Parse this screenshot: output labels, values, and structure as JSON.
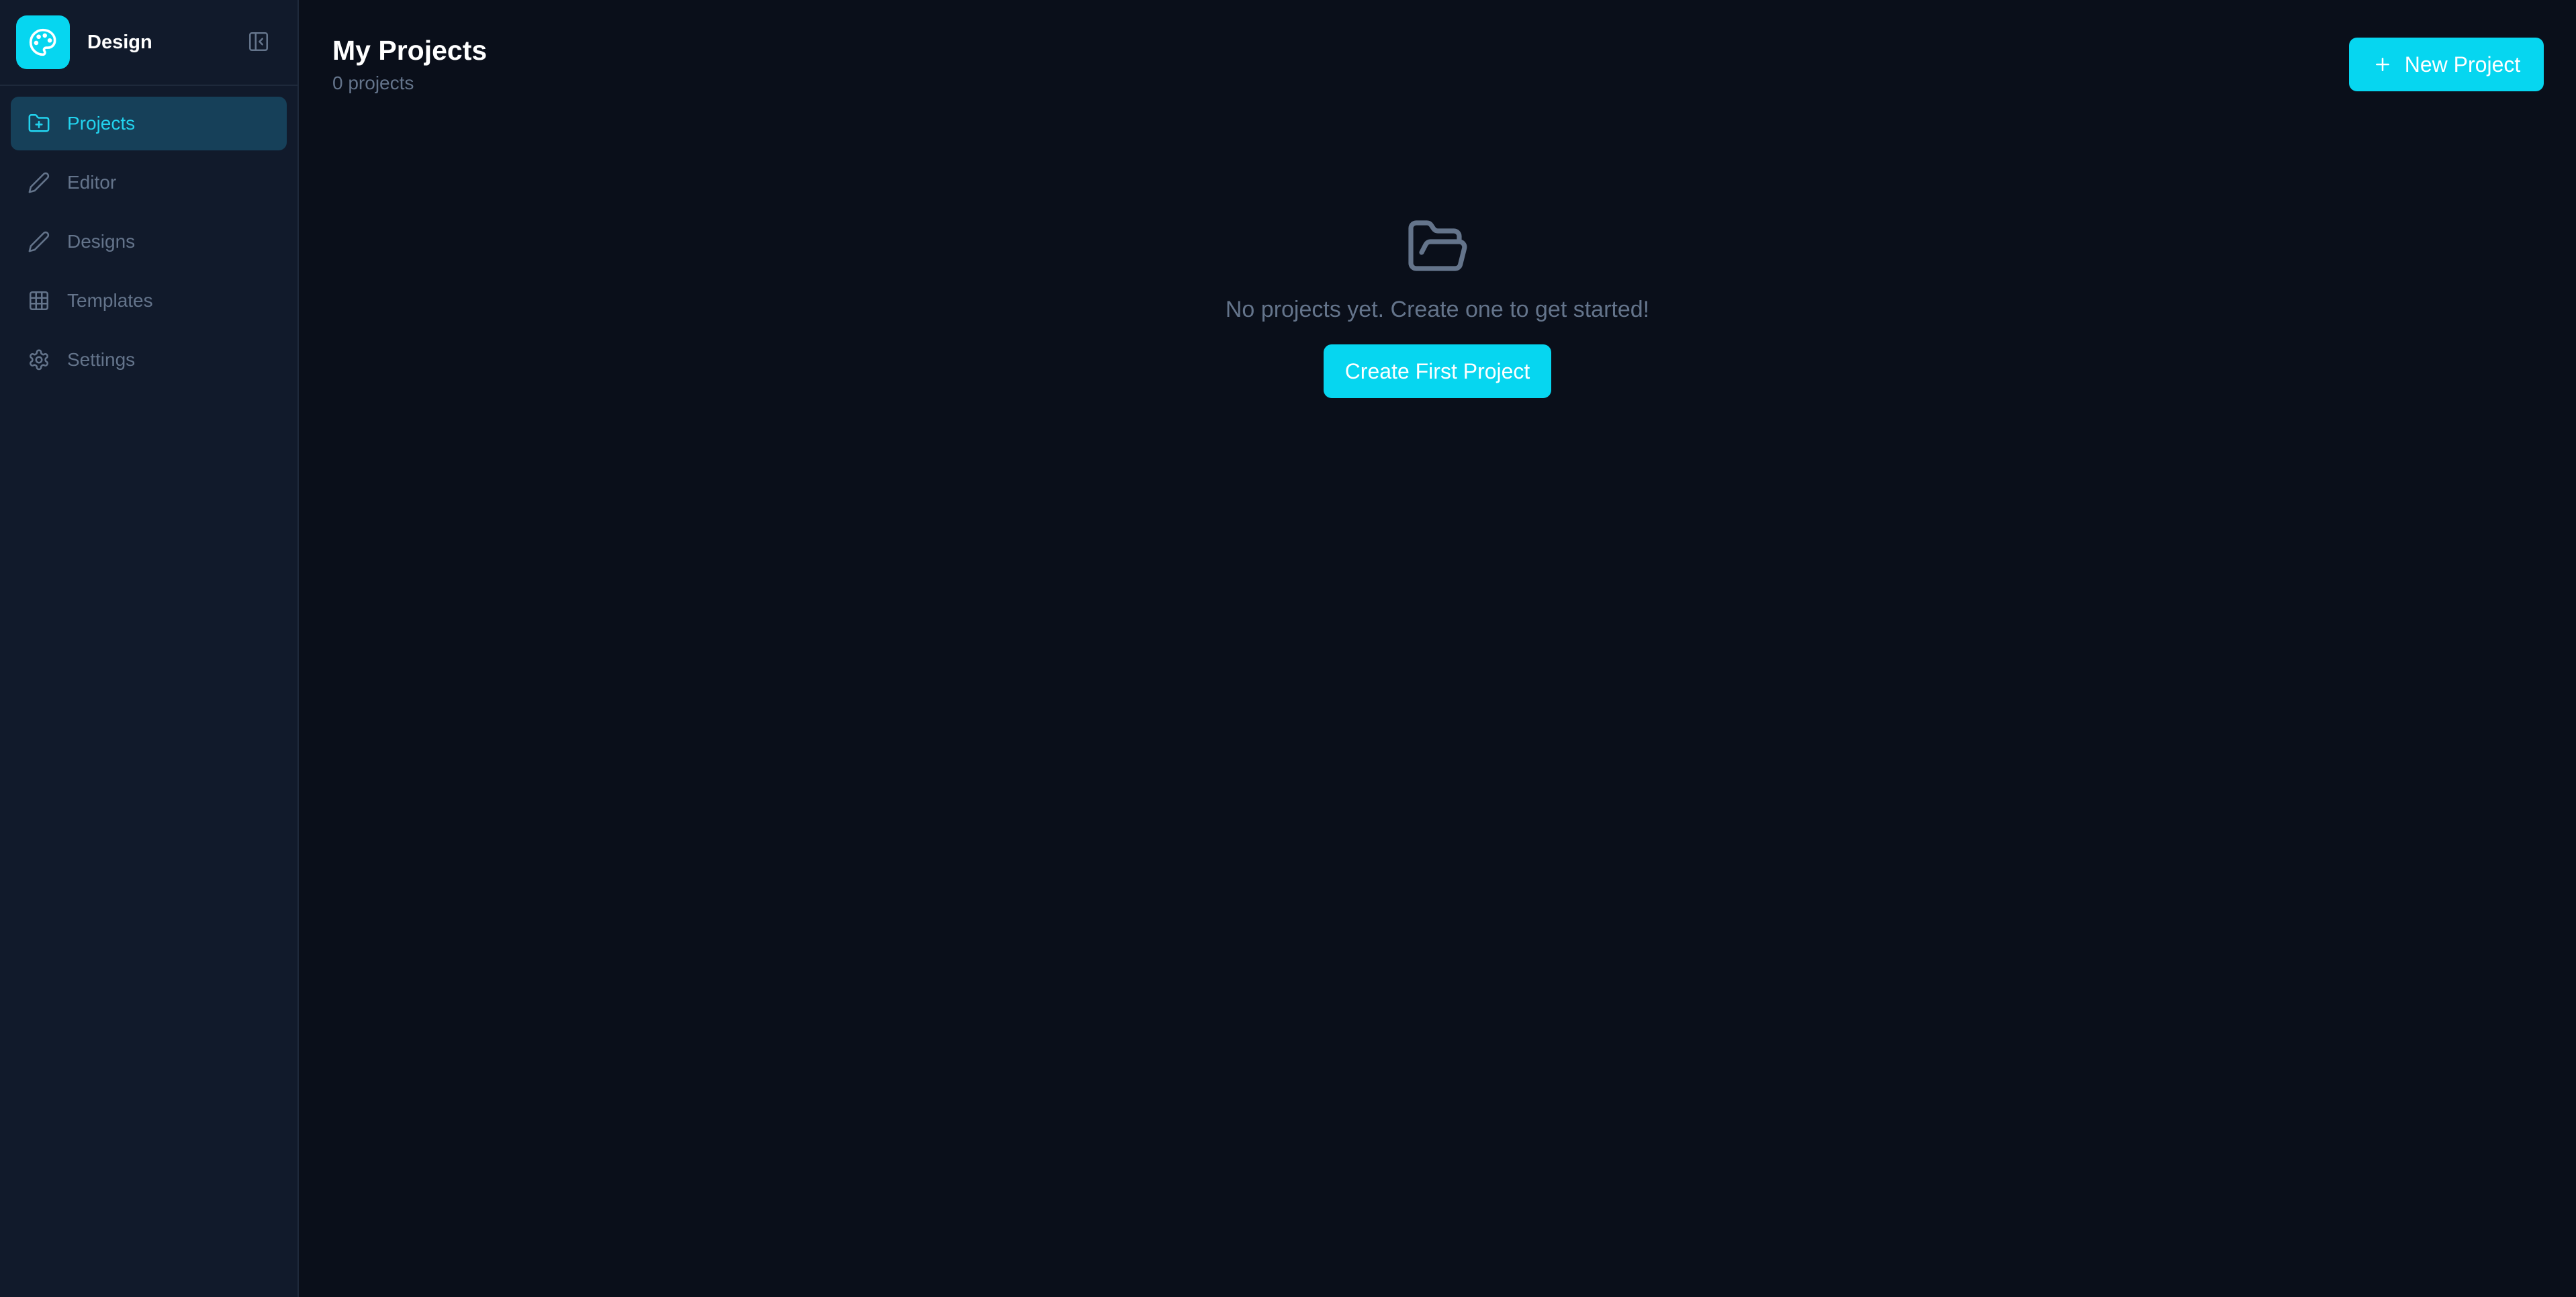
{
  "app": {
    "name": "Design",
    "accent_color": "#06d6f0"
  },
  "sidebar": {
    "items": [
      {
        "label": "Projects",
        "icon": "folder-plus-icon",
        "active": true
      },
      {
        "label": "Editor",
        "icon": "pen-icon",
        "active": false
      },
      {
        "label": "Designs",
        "icon": "pen-icon",
        "active": false
      },
      {
        "label": "Templates",
        "icon": "grid-icon",
        "active": false
      },
      {
        "label": "Settings",
        "icon": "gear-icon",
        "active": false
      }
    ],
    "collapse_icon": "panel-collapse-icon"
  },
  "header": {
    "title": "My Projects",
    "subtitle": "0 projects",
    "new_project_label": "New Project"
  },
  "empty_state": {
    "icon": "folder-open-icon",
    "message": "No projects yet. Create one to get started!",
    "button_label": "Create First Project"
  }
}
